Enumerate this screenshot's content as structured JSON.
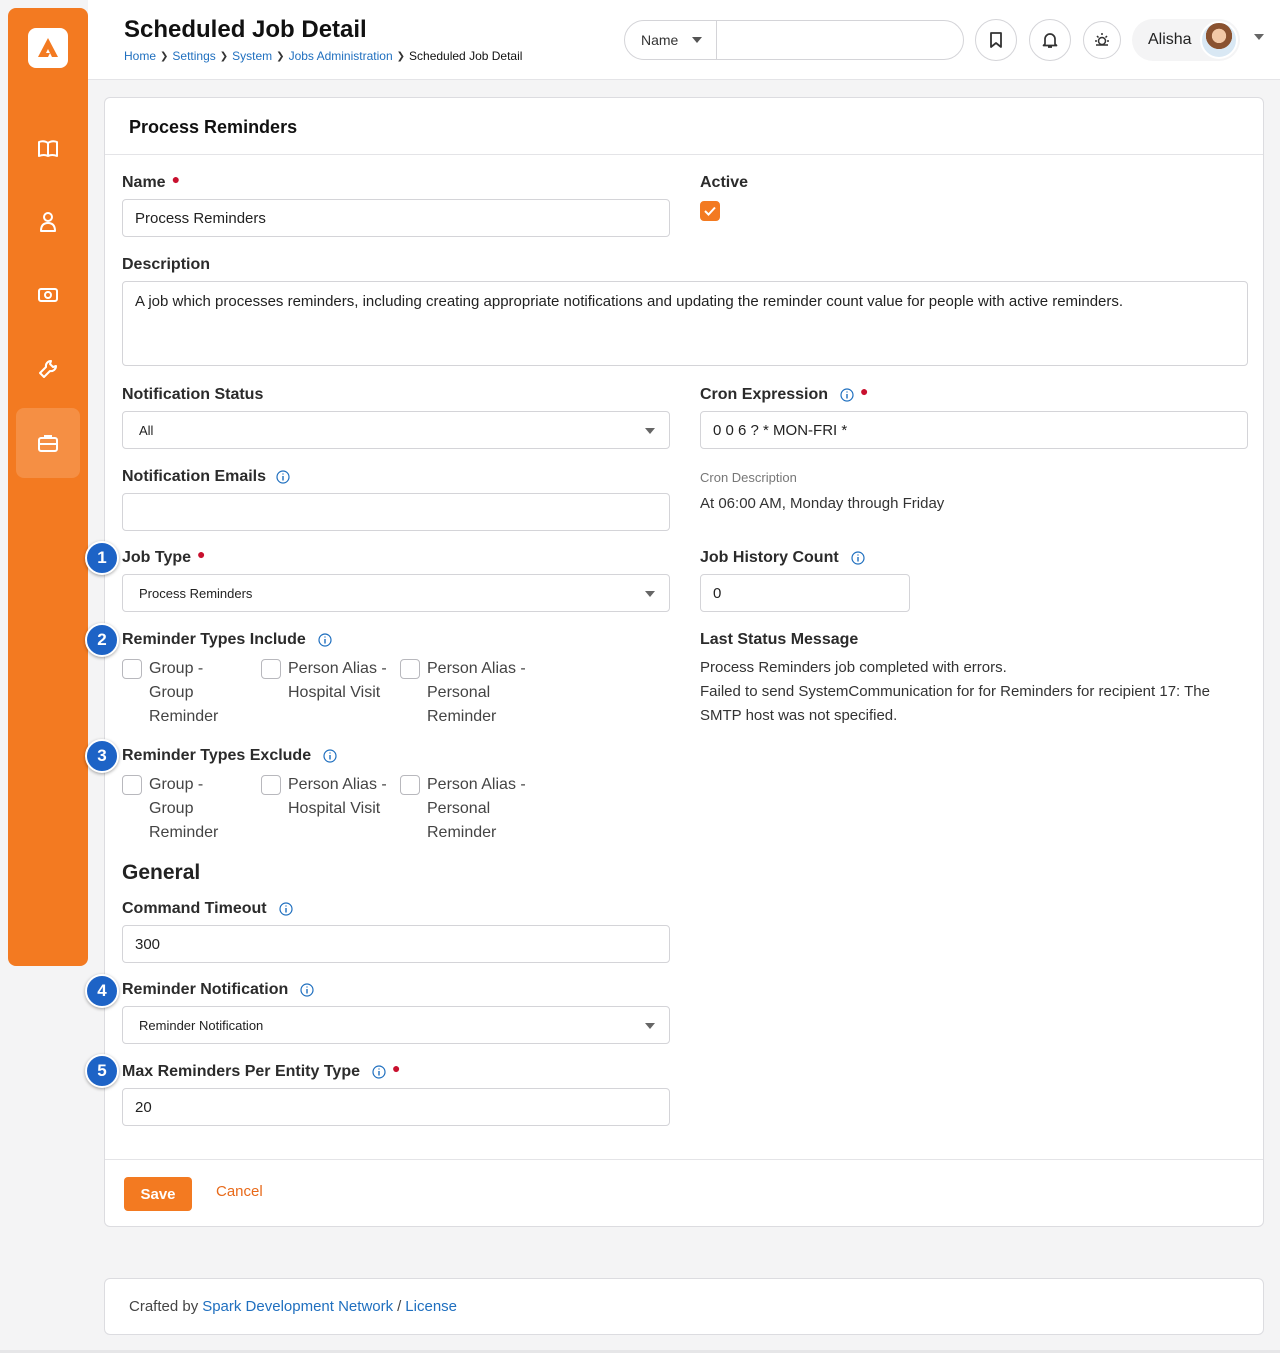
{
  "header": {
    "title": "Scheduled Job Detail",
    "breadcrumb": [
      "Home",
      "Settings",
      "System",
      "Jobs Administration",
      "Scheduled Job Detail"
    ],
    "search_type": "Name",
    "search_placeholder": "",
    "user_name": "Alisha"
  },
  "sidebar": {
    "items": [
      {
        "icon": "book-icon"
      },
      {
        "icon": "person-icon"
      },
      {
        "icon": "money-icon"
      },
      {
        "icon": "wrench-icon"
      },
      {
        "icon": "briefcase-icon",
        "active": true
      }
    ]
  },
  "panel": {
    "title": "Process Reminders",
    "name_label": "Name",
    "name_value": "Process Reminders",
    "active_label": "Active",
    "active_checked": true,
    "description_label": "Description",
    "description_value": "A job which processes reminders, including creating appropriate notifications and updating the reminder count value for people with active reminders.",
    "notification_status_label": "Notification Status",
    "notification_status_value": "All",
    "cron_expression_label": "Cron Expression",
    "cron_expression_value": "0 0 6 ? * MON-FRI *",
    "notification_emails_label": "Notification Emails",
    "notification_emails_value": "",
    "cron_description_label": "Cron Description",
    "cron_description_value": "At 06:00 AM, Monday through Friday",
    "job_type_label": "Job Type",
    "job_type_value": "Process Reminders",
    "job_history_count_label": "Job History Count",
    "job_history_count_value": "0",
    "reminder_types_include_label": "Reminder Types Include",
    "reminder_types_exclude_label": "Reminder Types Exclude",
    "reminder_type_options": [
      "Group - Group Reminder",
      "Person Alias - Hospital Visit",
      "Person Alias - Personal Reminder"
    ],
    "last_status_label": "Last Status Message",
    "last_status_line1": "Process Reminders job completed with errors.",
    "last_status_line2": "Failed to send SystemCommunication for for Reminders for recipient 17: The SMTP host was not specified.",
    "general_heading": "General",
    "command_timeout_label": "Command Timeout",
    "command_timeout_value": "300",
    "reminder_notification_label": "Reminder Notification",
    "reminder_notification_value": "Reminder Notification",
    "max_reminders_label": "Max Reminders Per Entity Type",
    "max_reminders_value": "20",
    "save_label": "Save",
    "cancel_label": "Cancel"
  },
  "badges": [
    "1",
    "2",
    "3",
    "4",
    "5"
  ],
  "footer": {
    "crafted_by": "Crafted by",
    "link1": "Spark Development Network",
    "separator": "/",
    "link2": "License"
  },
  "colors": {
    "accent": "#f37a21",
    "link": "#1f6fbf",
    "badge": "#1d63c6",
    "required": "#c8102e"
  }
}
